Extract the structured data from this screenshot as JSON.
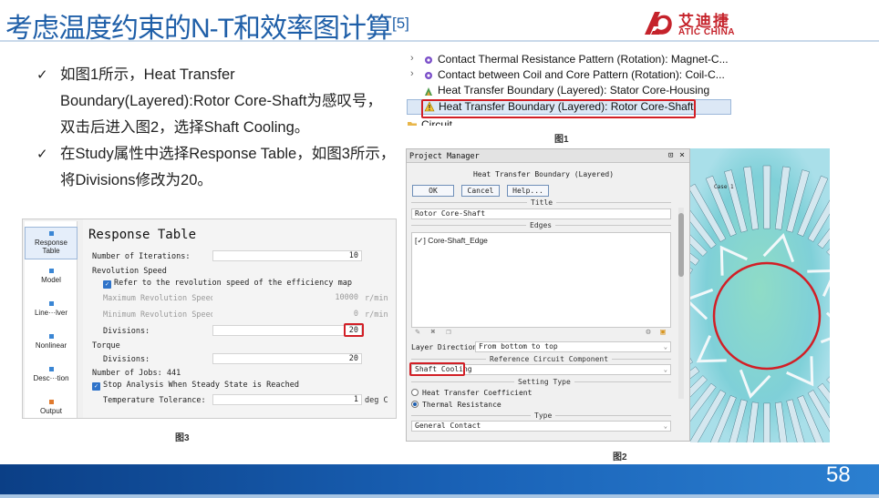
{
  "slide": {
    "title": "考虑温度约束的N-T和效率图计算",
    "title_ref": "[5]",
    "page_number": "58",
    "logo": {
      "cn": "艾迪捷",
      "en": "ATIC CHINA",
      "color": "#c5232b"
    },
    "accent_color": "#1f5fa8"
  },
  "bullets": [
    {
      "icon": "check-icon",
      "lines": [
        "如图1所示，Heat Transfer",
        "Boundary(Layered):Rotor Core-Shaft为感叹号，",
        "双击后进入图2，选择Shaft Cooling。"
      ]
    },
    {
      "icon": "check-icon",
      "lines": [
        "在Study属性中选择Response Table，如图3所示，",
        "将Divisions修改为20。"
      ]
    }
  ],
  "figure1": {
    "caption": "图1",
    "rows": [
      {
        "expand": "›",
        "text": "Contact Thermal Resistance Pattern (Rotation): Magnet-C..."
      },
      {
        "expand": "›",
        "text": "Contact between Coil and Core Pattern (Rotation): Coil-C..."
      },
      {
        "expand": "",
        "text": "Heat Transfer Boundary (Layered): Stator Core-Housing"
      },
      {
        "expand": "",
        "text": "Heat Transfer Boundary (Layered): Rotor Core-Shaft",
        "warning": true
      },
      {
        "expand": "",
        "text": "Circuit"
      }
    ]
  },
  "figure3": {
    "caption": "图3",
    "nav": [
      "Response Table",
      "Model",
      "Line···lver",
      "Nonlinear",
      "Desc···tion",
      "Output"
    ],
    "title": "Response Table",
    "number_of_iterations": {
      "label": "Number of Iterations:",
      "value": "10"
    },
    "revolution_speed": {
      "label": "Revolution Speed"
    },
    "refer_checkbox": {
      "label": "Refer to the revolution speed of the efficiency map",
      "checked": true
    },
    "max_speed": {
      "label": "Maximum Revolution Speed:",
      "value": "10000",
      "unit": "r/min"
    },
    "min_speed": {
      "label": "Minimum Revolution Speed:",
      "value": "0",
      "unit": "r/min"
    },
    "speed_divisions": {
      "label": "Divisions:",
      "value": "20"
    },
    "torque": {
      "label": "Torque"
    },
    "torque_divisions": {
      "label": "Divisions:",
      "value": "20"
    },
    "jobs": {
      "label": "Number of Jobs: 441"
    },
    "stop_checkbox": {
      "label": "Stop Analysis When Steady State is Reached",
      "checked": true
    },
    "temp_tolerance": {
      "label": "Temperature Tolerance:",
      "value": "1",
      "unit": "deg C"
    }
  },
  "figure2": {
    "caption": "图2",
    "window_title": "Project Manager",
    "pin": "⊡",
    "close": "×",
    "dialog_title": "Heat Transfer Boundary (Layered)",
    "buttons": {
      "ok": "OK",
      "cancel": "Cancel",
      "help": "Help..."
    },
    "title_section": "Title",
    "title_value": "Rotor Core-Shaft",
    "edges_section": "Edges",
    "edge_item": "Core-Shaft_Edge",
    "layer_direction": {
      "label": "Layer Direction:",
      "value": "From bottom to top"
    },
    "ref_circuit_section": "Reference Circuit Component",
    "ref_circuit_value": "Shaft Cooling",
    "setting_type_section": "Setting Type",
    "setting_options": [
      {
        "label": "Heat Transfer Coefficient",
        "selected": false
      },
      {
        "label": "Thermal Resistance",
        "selected": true
      }
    ],
    "type_section": "Type",
    "type_value": "General Contact"
  },
  "motor": {
    "case_label": "Case 1"
  },
  "colors": {
    "highlight_red": "#d21f26",
    "footer_blue": "#1a63b8"
  }
}
